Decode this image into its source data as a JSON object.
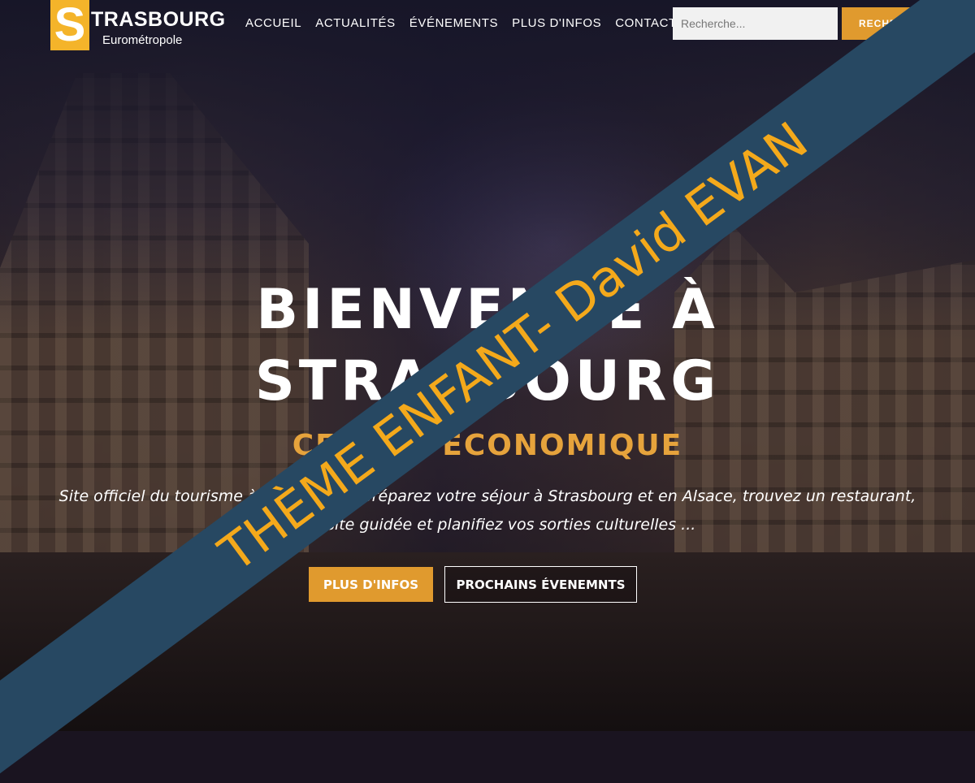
{
  "brand": {
    "logo_letter": "S",
    "name": "TRASBOURG",
    "subtitle": "Eurométropole",
    "accent": "#f4b42a"
  },
  "nav": [
    {
      "label": "ACCUEIL"
    },
    {
      "label": "ACTUALITÉS"
    },
    {
      "label": "ÉVÉNEMENTS"
    },
    {
      "label": "PLUS D'INFOS"
    },
    {
      "label": "CONTACT"
    }
  ],
  "search": {
    "placeholder": "Recherche...",
    "button": "RECHERCHER"
  },
  "hero": {
    "title_line1": "BIENVENUE À",
    "title_line2": "STRASBOURG",
    "subtitle": "CENTRE ECONOMIQUE",
    "description": "Site officiel du tourisme à Strasbourg : préparez votre séjour à Strasbourg et en Alsace, trouvez un restaurant, une visite guidée et planifiez vos sorties culturelles ...",
    "primary_button": "PLUS D'INFOS",
    "secondary_button": "PROCHAINS ÉVENEMNTS"
  },
  "ribbon": {
    "text": "THÈME ENFANT- David EVAN",
    "color": "#f4a91b",
    "background": "#274862"
  }
}
